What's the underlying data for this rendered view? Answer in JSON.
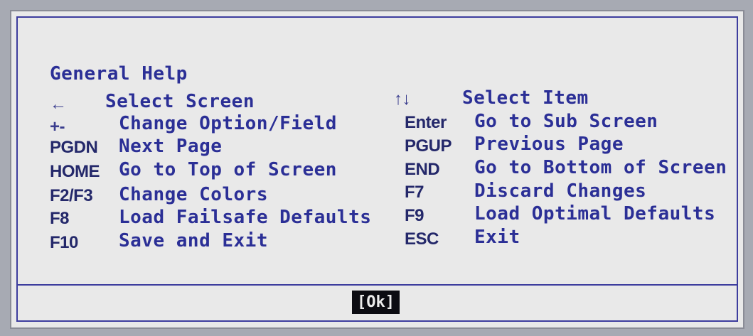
{
  "dialog": {
    "title": "General Help",
    "left_column": [
      {
        "key": "←",
        "action": "Select Screen"
      },
      {
        "key": "+-",
        "action": "Change Option/Field"
      },
      {
        "key": "PGDN",
        "action": "Next Page"
      },
      {
        "key": "HOME",
        "action": "Go to Top of Screen"
      },
      {
        "key": "F2/F3",
        "action": "Change Colors"
      },
      {
        "key": "F8",
        "action": "Load Failsafe Defaults"
      },
      {
        "key": "F10",
        "action": "Save and Exit"
      }
    ],
    "right_column": [
      {
        "key": "↑↓",
        "action": "Select Item"
      },
      {
        "key": "Enter",
        "action": "Go to Sub Screen"
      },
      {
        "key": "PGUP",
        "action": "Previous Page"
      },
      {
        "key": "END",
        "action": "Go to Bottom of Screen"
      },
      {
        "key": "F7",
        "action": "Discard Changes"
      },
      {
        "key": "F9",
        "action": "Load Optimal Defaults"
      },
      {
        "key": "ESC",
        "action": "Exit"
      }
    ],
    "ok_label": "[Ok]"
  },
  "colors": {
    "text": "#2b2f96",
    "background": "#e9e9e9",
    "border": "#3d3d9e",
    "ok_background": "#0c0c12",
    "ok_text": "#ececec"
  }
}
